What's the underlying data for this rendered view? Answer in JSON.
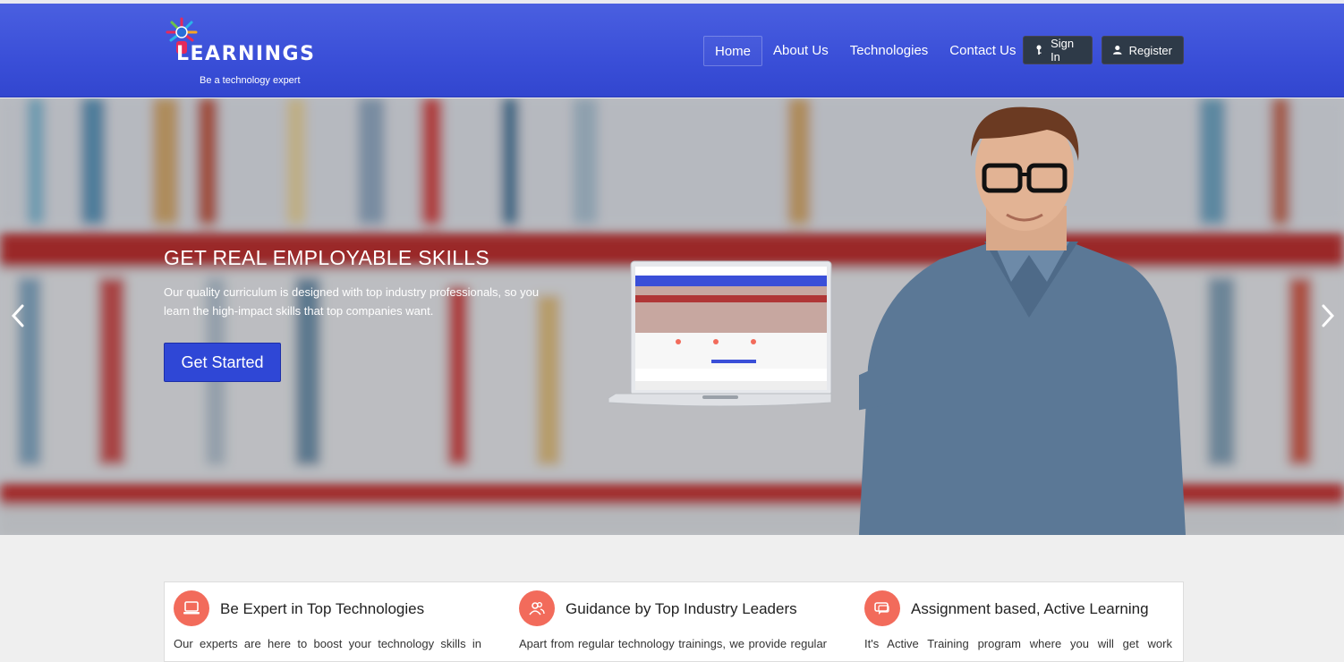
{
  "brand": {
    "name": "LEARNINGS",
    "tagline": "Be a technology expert"
  },
  "nav": {
    "items": [
      {
        "label": "Home"
      },
      {
        "label": "About Us"
      },
      {
        "label": "Technologies"
      },
      {
        "label": "Contact Us"
      }
    ],
    "signin_label": "Sign In",
    "register_label": "Register"
  },
  "hero": {
    "title": "GET REAL EMPLOYABLE SKILLS",
    "text": "Our quality curriculum is designed with top industry professionals, so you learn the high-impact skills that top companies want.",
    "cta_label": "Get Started"
  },
  "features": [
    {
      "title": "Be Expert in Top Technologies",
      "text": "Our experts are here to boost your technology skills in",
      "icon": "laptop-icon"
    },
    {
      "title": "Guidance by Top Industry Leaders",
      "text": "Apart from regular technology trainings, we provide regular",
      "icon": "users-icon"
    },
    {
      "title": "Assignment based, Active Learning",
      "text": "It's Active Training program where you will get work",
      "icon": "chat-icon"
    }
  ],
  "colors": {
    "navbar": "#3a4fd8",
    "cta": "#2f47d6",
    "feature_icon": "#f26b5b"
  }
}
